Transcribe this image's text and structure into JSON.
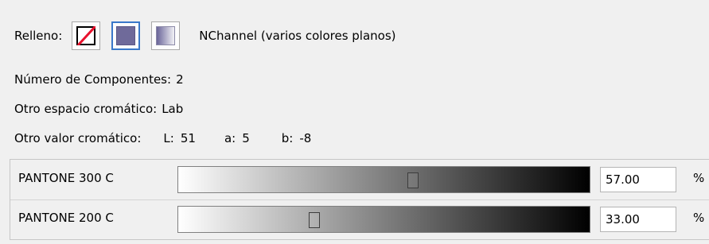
{
  "fill": {
    "label": "Relleno:",
    "options": [
      {
        "name": "none",
        "selected": false
      },
      {
        "name": "flat",
        "selected": true
      },
      {
        "name": "gradient",
        "selected": false
      }
    ],
    "type_text": "NChannel (varios colores planos)"
  },
  "components": {
    "label": "Número de Componentes:",
    "value": "2"
  },
  "alt_colorspace": {
    "label": "Otro espacio cromático:",
    "value": "Lab"
  },
  "alt_colorvalue": {
    "label": "Otro valor cromático:",
    "l_label": "L:",
    "l_value": "51",
    "a_label": "a:",
    "a_value": "5",
    "b_label": "b:",
    "b_value": "-8"
  },
  "inks": [
    {
      "name": "PANTONE 300 C",
      "value": "57.00",
      "unit": "%",
      "level": 0.57
    },
    {
      "name": "PANTONE 200 C",
      "value": "33.00",
      "unit": "%",
      "level": 0.33
    }
  ],
  "colors": {
    "flat_fill": "#6f6a9a",
    "selection_border": "#3a78c9"
  }
}
